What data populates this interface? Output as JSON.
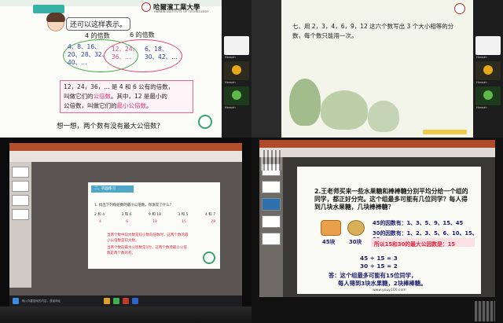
{
  "q1": {
    "logo_cn": "哈爾濱工業大學",
    "logo_en": "HARBIN INSTITUTE OF TECHNOLOGY",
    "bubble": "还可以这样表示。",
    "label_4": "4 的倍数",
    "label_6": "6 的倍数",
    "left_nums": [
      "4、8、16、",
      "20、28、32、",
      "40、…"
    ],
    "mid_nums": [
      "12、24、",
      "36、…"
    ],
    "right_nums": [
      "6、18、",
      "30、42、…"
    ],
    "def_lines": [
      {
        "a": "12，24，36，… 是 4 和 6 公有的倍数，",
        "r": "",
        "b": ""
      },
      {
        "a": "叫做它们的",
        "r": "公倍数",
        "b": "。其中，12 是最小的"
      },
      {
        "a": "公倍数，叫做它们的",
        "r": "最小公倍数",
        "b": "。"
      }
    ],
    "question": "想一想，两个数有没有最大公倍数?",
    "participants": [
      "Hannah",
      "Hannah",
      "Hannah"
    ]
  },
  "q2": {
    "task": "七、用 2，3，4，6，9，12 这六个数写出 3 个大小相等的分数，每个数只能用一次。",
    "participants": [
      "Hannah",
      "Hannah",
      "Hannah"
    ]
  },
  "q3": {
    "slide_header": "二、巩固练习",
    "slide_task": "1. 找出下列每组数的最小公倍数，你发现了什么？",
    "pairs": [
      "2 和 4",
      "3 和 6",
      "9 和 18",
      "3 和 5",
      "4 和 7"
    ],
    "answers": [
      "4",
      "6",
      "18",
      "15",
      "28"
    ],
    "note_lines": [
      "当两个数中较大数是较小数的倍数时，这两个数的最",
      "小公倍数是较大数。",
      "当两个数的最大公因数是1时，这两个数的最小公倍",
      "数是两个数的积。"
    ],
    "status": "输入你要搜索的内容，或者网址"
  },
  "q4": {
    "task": "2.王老师买来一些水果糖和棒棒糖分别平均分给一个组的同学，都正好分完。这个组最多可能有几位同学？每人得到几块水果糖，几块棒棒糖？",
    "candy1": "45块",
    "candy2": "30块",
    "line1": "45的因数有：1、3、5、9、15、45",
    "line2": "30的因数有：1、2、3、5、6、10、15、30",
    "gcd_line": "所以15和30的最大公因数是：15",
    "calc1": "45 ÷ 15 = 3",
    "calc2": "30 ÷ 15 = 2",
    "answer1": "答：这个组最多可能有15位同学，",
    "answer2": "每人得到3块水果糖，2块棒棒糖。",
    "url": "www.youy100.com"
  }
}
